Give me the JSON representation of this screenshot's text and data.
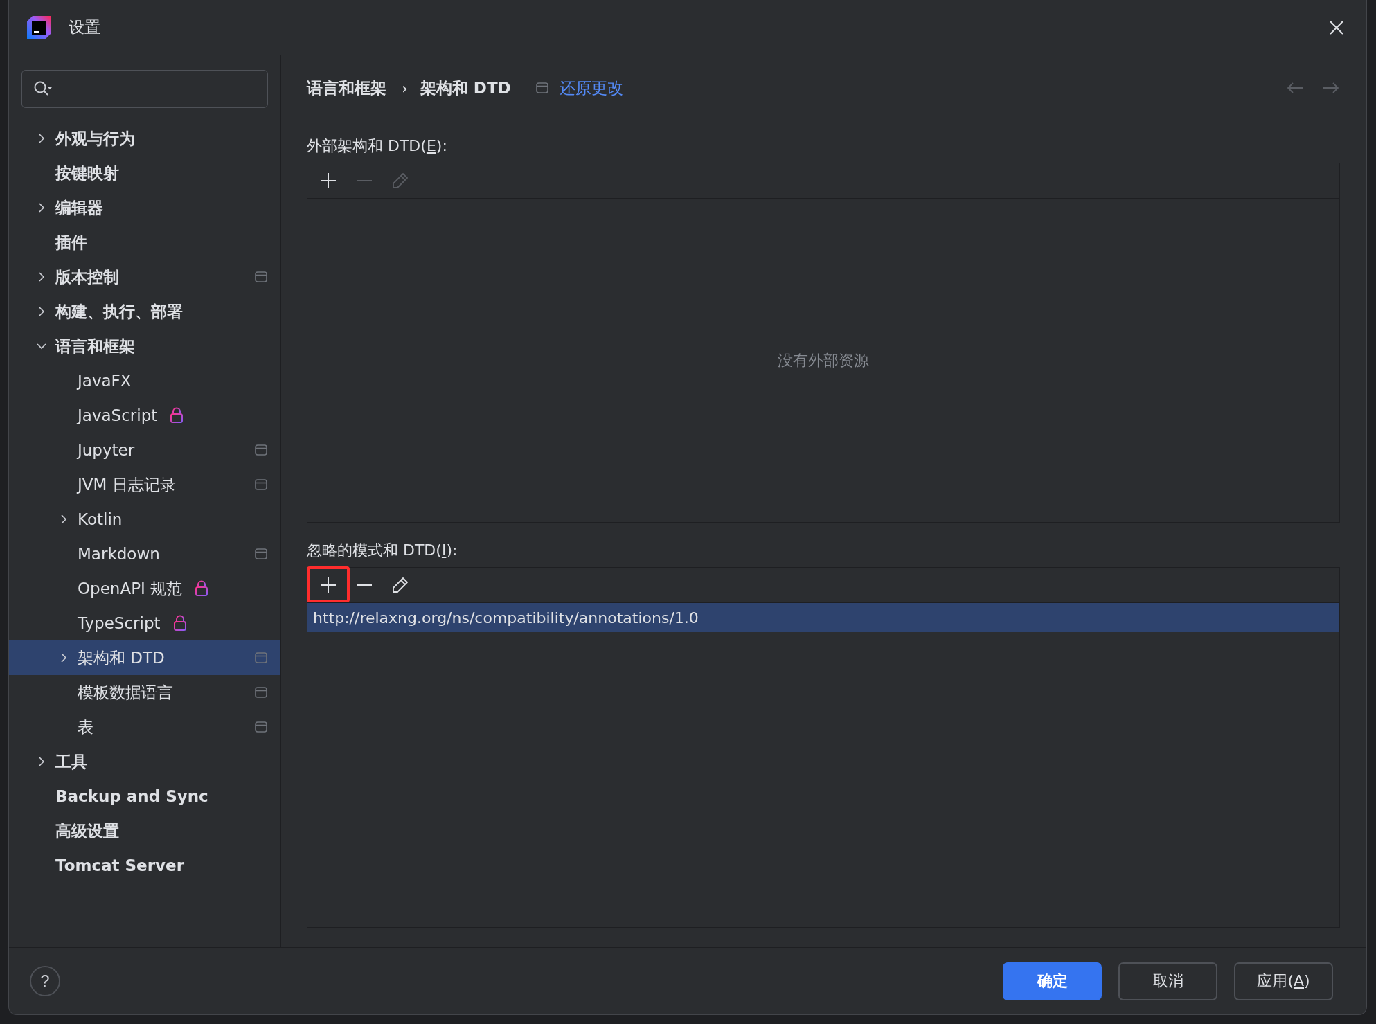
{
  "window": {
    "title": "设置"
  },
  "sidebar": {
    "items": [
      {
        "label": "外观与行为",
        "expanded": false,
        "selected": false
      },
      {
        "label": "按键映射",
        "selected": false
      },
      {
        "label": "编辑器",
        "expanded": false,
        "selected": false
      },
      {
        "label": "插件",
        "selected": false
      },
      {
        "label": "版本控制",
        "expanded": false,
        "project_scope": true,
        "selected": false
      },
      {
        "label": "构建、执行、部署",
        "expanded": false,
        "selected": false
      },
      {
        "label": "语言和框架",
        "expanded": true,
        "selected": false,
        "children": [
          {
            "label": "JavaFX",
            "selected": false
          },
          {
            "label": "JavaScript",
            "locked": true,
            "selected": false
          },
          {
            "label": "Jupyter",
            "project_scope": true,
            "selected": false
          },
          {
            "label": "JVM 日志记录",
            "project_scope": true,
            "selected": false
          },
          {
            "label": "Kotlin",
            "expanded": false,
            "selected": false
          },
          {
            "label": "Markdown",
            "project_scope": true,
            "selected": false
          },
          {
            "label": "OpenAPI 规范",
            "locked": true,
            "selected": false
          },
          {
            "label": "TypeScript",
            "locked": true,
            "selected": false
          },
          {
            "label": "架构和 DTD",
            "expanded": false,
            "project_scope": true,
            "selected": true
          },
          {
            "label": "模板数据语言",
            "project_scope": true,
            "selected": false
          },
          {
            "label": "表",
            "project_scope": true,
            "selected": false
          }
        ]
      },
      {
        "label": "工具",
        "expanded": false,
        "selected": false
      },
      {
        "label": "Backup and Sync",
        "selected": false
      },
      {
        "label": "高级设置",
        "selected": false
      },
      {
        "label": "Tomcat Server",
        "selected": false
      }
    ]
  },
  "breadcrumb": {
    "items": [
      "语言和框架",
      "架构和 DTD"
    ],
    "separator": "›",
    "reset_link": "还原更改"
  },
  "sections": [
    {
      "label": {
        "before": "外部架构和 DTD(",
        "mnemonic": "E",
        "after": "):"
      },
      "toolbar": [
        {
          "kind": "add",
          "disabled": false,
          "highlighted": false
        },
        {
          "kind": "remove",
          "disabled": true,
          "highlighted": false
        },
        {
          "kind": "edit",
          "disabled": true,
          "highlighted": false
        }
      ],
      "empty_text": "没有外部资源"
    },
    {
      "label": {
        "before": "忽略的模式和 DTD(",
        "mnemonic": "I",
        "after": "):"
      },
      "toolbar": [
        {
          "kind": "add",
          "disabled": false,
          "highlighted": true
        },
        {
          "kind": "remove",
          "disabled": false,
          "highlighted": false
        },
        {
          "kind": "edit",
          "disabled": false,
          "highlighted": false
        }
      ],
      "rows": [
        {
          "text": "http://relaxng.org/ns/compatibility/annotations/1.0",
          "selected": true
        }
      ]
    }
  ],
  "footer": {
    "help": "?",
    "buttons": [
      {
        "kind": "primary",
        "before": "确定"
      },
      {
        "kind": "normal",
        "before": "取消"
      },
      {
        "kind": "normal",
        "before": "应用(",
        "mnemonic": "A",
        "after": ")"
      }
    ]
  }
}
